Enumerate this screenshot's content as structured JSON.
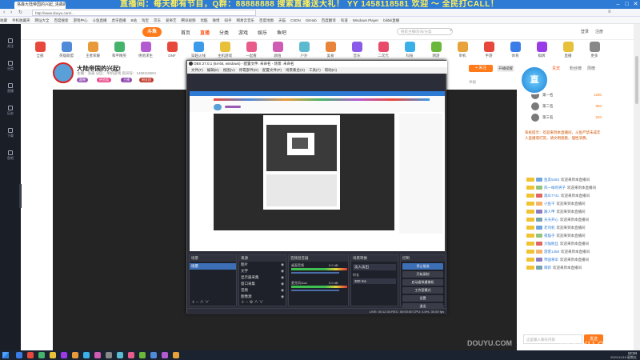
{
  "browser": {
    "tab_title": "洛森大陆帝国的兴起_洛森的直播间",
    "marquee": "直播间：每天都有节目，Q群：88888888  搜索直播送大礼！  YY 1458118581 欢迎 ～ 全民打CALL！",
    "address": "http://www.douyu.com/...",
    "bookmarks": [
      "收藏",
      "手机收藏夹",
      "网址大全",
      "百度搜索",
      "游戏中心",
      "斗鱼直播",
      "虎牙直播",
      "B站",
      "淘宝",
      "京东",
      "爱奇艺",
      "腾讯视频",
      "优酷",
      "微博",
      "知乎",
      "网易云音乐",
      "百度地图",
      "天猫",
      "CSDN",
      "GitHub",
      "百度翻译",
      "有道",
      "Windows Player",
      "bilibili直播"
    ]
  },
  "leftbar": {
    "items": [
      "关注",
      "分类",
      "直播",
      "历史",
      "下载",
      "鱼吧"
    ]
  },
  "site": {
    "logo": "斗鱼",
    "nav": [
      "首页",
      "直播",
      "分类",
      "游戏",
      "娱乐",
      "鱼吧"
    ],
    "search_placeholder": "搜索主播/房间/分类",
    "login": "登录",
    "register": "注册"
  },
  "categories": [
    {
      "label": "全部",
      "color": "#e8483b"
    },
    {
      "label": "英雄联盟",
      "color": "#4f8bd8"
    },
    {
      "label": "王者荣耀",
      "color": "#e89a3b"
    },
    {
      "label": "和平精英",
      "color": "#45b36b"
    },
    {
      "label": "绝地求生",
      "color": "#b35bd0"
    },
    {
      "label": "DNF",
      "color": "#e8483b"
    },
    {
      "label": "穿越火线",
      "color": "#3b9be8"
    },
    {
      "label": "主机游戏",
      "color": "#e8c13b"
    },
    {
      "label": "一起看",
      "color": "#e85b8a"
    },
    {
      "label": "颜值",
      "color": "#d05bb3"
    },
    {
      "label": "户外",
      "color": "#5bbad0"
    },
    {
      "label": "美食",
      "color": "#e8853b"
    },
    {
      "label": "音乐",
      "color": "#8a5be8"
    },
    {
      "label": "二次元",
      "color": "#e84b6a"
    },
    {
      "label": "科技",
      "color": "#3bb0e8"
    },
    {
      "label": "网游",
      "color": "#6ab83b"
    },
    {
      "label": "单机",
      "color": "#e8a23b"
    },
    {
      "label": "手游",
      "color": "#e8483b"
    },
    {
      "label": "体育",
      "color": "#3b7de8"
    },
    {
      "label": "棋牌",
      "color": "#9a3be8"
    },
    {
      "label": "直播",
      "color": "#e8c13b"
    },
    {
      "label": "更多",
      "color": "#888888"
    }
  ],
  "room": {
    "title": "大陆帝国的兴起!",
    "meta": "主播：洛森  分区：单机游戏  房间号：1458118581",
    "tags": [
      "超神",
      "经验值",
      "主播",
      "粉丝团"
    ],
    "follow_label": "+ 关注",
    "open_label": "开播提醒",
    "report_label": "举报"
  },
  "obs": {
    "title": "OBS 27.0.1 (64-bit, windows) - 配置文件: 未命名 - 场景: 未命名",
    "menu": [
      "文件(F)",
      "编辑(E)",
      "视图(V)",
      "停靠部件(D)",
      "配置文件(P)",
      "场景集合(S)",
      "工具(T)",
      "帮助(H)"
    ],
    "panels": {
      "scenes": "场景",
      "sources": "来源",
      "mixer": "音频混音器",
      "transitions": "场景转换",
      "controls": "控制"
    },
    "scene_name": "场景",
    "sources": [
      "图片",
      "文字",
      "显示器采集",
      "窗口采集",
      "音频",
      "图像源"
    ],
    "mixer": [
      "桌面音频",
      "麦克风/Aux"
    ],
    "mixer_db": [
      "0.0 dB",
      "0.0 dB"
    ],
    "transition": "淡入淡出",
    "duration_label": "时长",
    "duration": "300 ms",
    "buttons": [
      "停止推流",
      "开始录制",
      "启动虚拟摄像机",
      "工作室模式",
      "设置",
      "退出"
    ],
    "status": "LIVE: 00:12:34   REC: 00:00:00   CPU: 4.6%, 30.00 fps"
  },
  "right": {
    "tabs": [
      "贵宾",
      "粉丝榜",
      "周榜"
    ],
    "rank": [
      {
        "name": "第一名",
        "score": "1280"
      },
      {
        "name": "第二名",
        "score": "960"
      },
      {
        "name": "第三名",
        "score": "520"
      }
    ],
    "notice": "系统提示：欢迎来到本直播间，斗鱼严禁未成年人直播或打赏，请文明观看，理性消费。",
    "chat": [
      {
        "user": "鱼友5283",
        "text": "欢迎来到本直播间"
      },
      {
        "user": "风一样的男子",
        "text": "欢迎来到本直播间"
      },
      {
        "user": "观众7741",
        "text": "欢迎来到本直播间"
      },
      {
        "user": "小鱼干",
        "text": "欢迎来到本直播间"
      },
      {
        "user": "路人甲",
        "text": "欢迎来到本直播间"
      },
      {
        "user": "天天开心",
        "text": "欢迎来到本直播间"
      },
      {
        "user": "老司机",
        "text": "欢迎来到本直播间"
      },
      {
        "user": "夜猫子",
        "text": "欢迎来到本直播间"
      },
      {
        "user": "大陆粉丝",
        "text": "欢迎来到本直播间"
      },
      {
        "user": "游客1458",
        "text": "欢迎来到本直播间"
      },
      {
        "user": "帝国将军",
        "text": "欢迎来到本直播间"
      },
      {
        "user": "萌新",
        "text": "欢迎来到本直播间"
      }
    ],
    "input_placeholder": "这里输入聊天内容",
    "send": "发送"
  },
  "taskbar": {
    "time": "12:34",
    "date": "2021/11/19 星期五"
  },
  "watermark": "DOUYU.COM"
}
